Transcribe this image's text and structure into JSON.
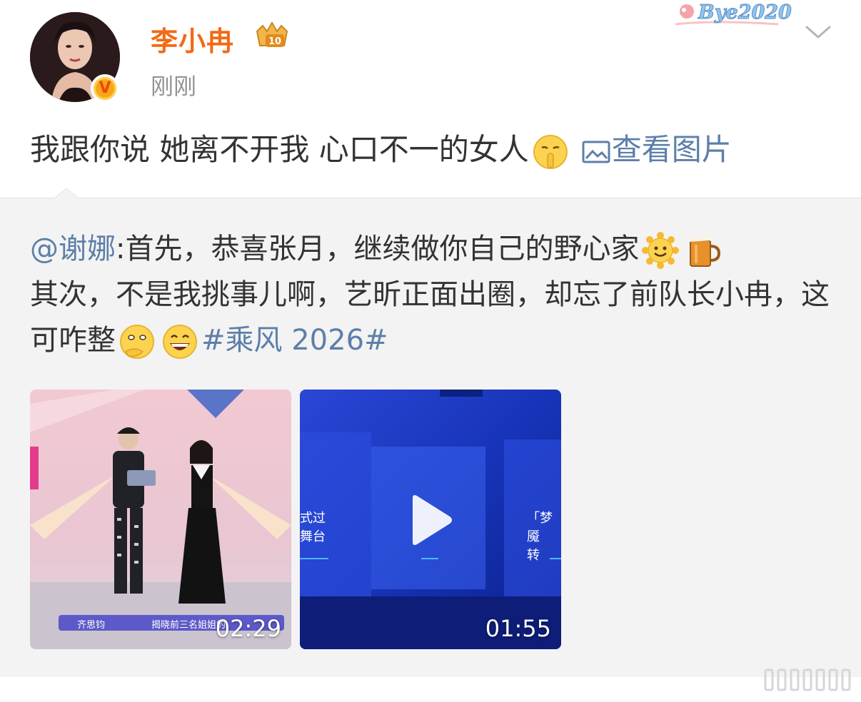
{
  "header": {
    "username": "李小冉",
    "timestamp": "刚刚",
    "vip_level": "10",
    "verified_badge": "V",
    "decoration_text": "Bye2020",
    "avatar_icon": "user-avatar",
    "menu_icon": "chevron-down-icon"
  },
  "post": {
    "text": "我跟你说 她离不开我 心口不一的女人",
    "emoji": "shush-emoji",
    "view_pic_label": "查看图片"
  },
  "repost": {
    "mention": "@谢娜",
    "body_part1": ":首先，恭喜张月，继续做你自己的野心家",
    "body_part2": "其次，不是我挑事儿啊，艺昕正面出圈，却忘了前队长小冉，这可咋整",
    "hashtag": "#乘风 2026#",
    "media": [
      {
        "duration": "02:29",
        "caption_left": "齐思钧",
        "caption_right": "揭晓前三名姐姐的"
      },
      {
        "duration": "01:55",
        "side_left": "式过\n舞台",
        "side_right": "「梦魇\n转",
        "play_icon": "play-icon"
      }
    ]
  },
  "colors": {
    "username": "#f26a16",
    "link": "#5d7fa9",
    "repost_bg": "#f3f3f3",
    "timestamp": "#939393"
  }
}
